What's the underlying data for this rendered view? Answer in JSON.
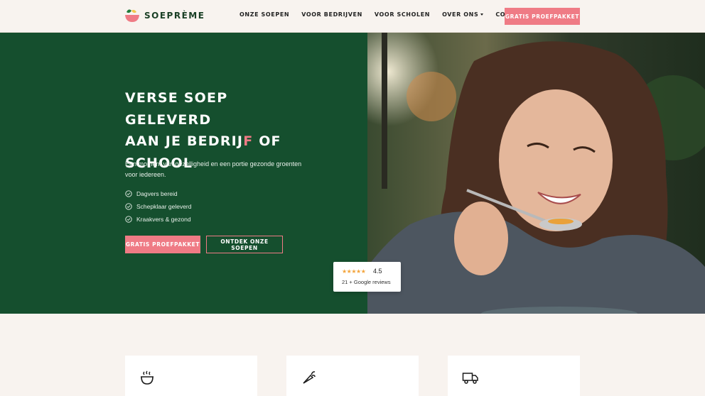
{
  "header": {
    "logo_text": "SOEPRÈME",
    "nav": [
      {
        "label": "ONZE SOEPEN"
      },
      {
        "label": "VOOR BEDRIJVEN"
      },
      {
        "label": "VOOR SCHOLEN"
      },
      {
        "label": "OVER ONS",
        "has_dropdown": true
      },
      {
        "label": "CONTACT"
      }
    ],
    "cta_label": "GRATIS PROEFPAKKET"
  },
  "hero": {
    "title_line1": "VERSE SOEP GELEVERD",
    "title_line2_pre": "AAN JE BEDRIJ",
    "title_line2_accent": "F",
    "title_line2_post": " OF",
    "title_line3": "SCHOOL",
    "subtitle": "Een moment van gezelligheid en een portie gezonde groenten voor iedereen.",
    "checks": [
      "Dagvers bereid",
      "Schepklaar geleverd",
      "Kraakvers & gezond"
    ],
    "primary_button": "GRATIS PROEFPAKKET",
    "secondary_button": "ONTDEK ONZE SOEPEN"
  },
  "reviews": {
    "stars": "★★★★★",
    "score": "4.5",
    "count_text": "21 + Google reviews"
  },
  "features": [
    {
      "icon": "soup-bowl-icon"
    },
    {
      "icon": "carrot-icon"
    },
    {
      "icon": "delivery-truck-icon"
    }
  ],
  "colors": {
    "brand_green": "#154f2e",
    "accent_pink": "#ef7b85",
    "background": "#f8f3ef",
    "star_color": "#f3a43b"
  }
}
